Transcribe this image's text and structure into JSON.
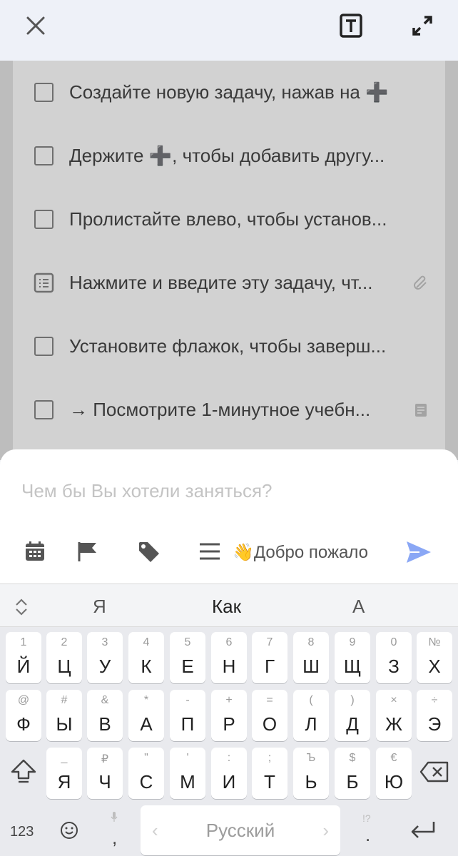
{
  "header": {
    "close_icon": "close-icon",
    "text_format_icon": "text-format-icon",
    "expand_icon": "expand-icon"
  },
  "tasks": [
    {
      "label": "Создайте новую задачу, нажав на ➕",
      "icon": "checkbox",
      "trailing": ""
    },
    {
      "label": "Держите ➕, чтобы добавить другу...",
      "icon": "checkbox",
      "trailing": ""
    },
    {
      "label": "Пролистайте влево, чтобы установ...",
      "icon": "checkbox",
      "trailing": ""
    },
    {
      "label": "Нажмите и введите эту задачу, чт...",
      "icon": "note-list",
      "trailing": "attachment-icon"
    },
    {
      "label": "Установите флажок, чтобы заверш...",
      "icon": "checkbox",
      "trailing": ""
    },
    {
      "label": "→ Посмотрите 1-минутное учебн...",
      "icon": "checkbox",
      "trailing": "note-icon"
    }
  ],
  "composer": {
    "placeholder": "Чем бы Вы хотели заняться?",
    "greeting": "👋Добро пожало",
    "accent": "#8aa7f5"
  },
  "keyboard": {
    "suggestions": [
      "Я",
      "Как",
      "А"
    ],
    "row1": [
      {
        "hint": "1",
        "main": "Й"
      },
      {
        "hint": "2",
        "main": "Ц"
      },
      {
        "hint": "3",
        "main": "У"
      },
      {
        "hint": "4",
        "main": "К"
      },
      {
        "hint": "5",
        "main": "Е"
      },
      {
        "hint": "6",
        "main": "Н"
      },
      {
        "hint": "7",
        "main": "Г"
      },
      {
        "hint": "8",
        "main": "Ш"
      },
      {
        "hint": "9",
        "main": "Щ"
      },
      {
        "hint": "0",
        "main": "З"
      },
      {
        "hint": "№",
        "main": "Х"
      }
    ],
    "row2": [
      {
        "hint": "@",
        "main": "Ф"
      },
      {
        "hint": "#",
        "main": "Ы"
      },
      {
        "hint": "&",
        "main": "В"
      },
      {
        "hint": "*",
        "main": "А"
      },
      {
        "hint": "-",
        "main": "П"
      },
      {
        "hint": "+",
        "main": "Р"
      },
      {
        "hint": "=",
        "main": "О"
      },
      {
        "hint": "(",
        "main": "Л"
      },
      {
        "hint": ")",
        "main": "Д"
      },
      {
        "hint": "×",
        "main": "Ж"
      },
      {
        "hint": "÷",
        "main": "Э"
      }
    ],
    "row3": [
      {
        "hint": "_",
        "main": "Я"
      },
      {
        "hint": "₽",
        "main": "Ч"
      },
      {
        "hint": "\"",
        "main": "С"
      },
      {
        "hint": "'",
        "main": "М"
      },
      {
        "hint": ":",
        "main": "И"
      },
      {
        "hint": ";",
        "main": "Т"
      },
      {
        "hint": "Ъ",
        "main": "Ь"
      },
      {
        "hint": "$",
        "main": "Б"
      },
      {
        "hint": "€",
        "main": "Ю"
      }
    ],
    "num_label": "123",
    "space_label": "Русский",
    "comma": ",",
    "period": ".",
    "period_hint": "!?"
  }
}
